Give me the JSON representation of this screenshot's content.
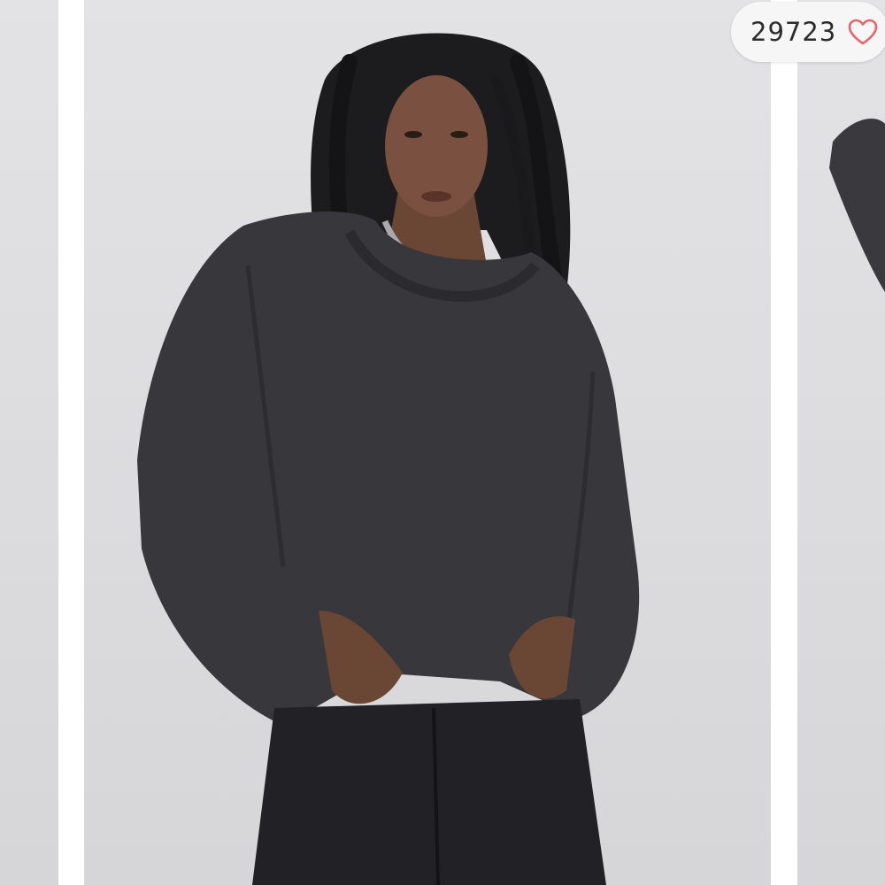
{
  "gallery": {
    "like_count": "29723",
    "accent_color": "#e8636c",
    "icon": "heart-outline-icon",
    "main_image": {
      "kind": "product-photo",
      "garment_color": "#38383c",
      "background_color": "#dedee0"
    }
  }
}
